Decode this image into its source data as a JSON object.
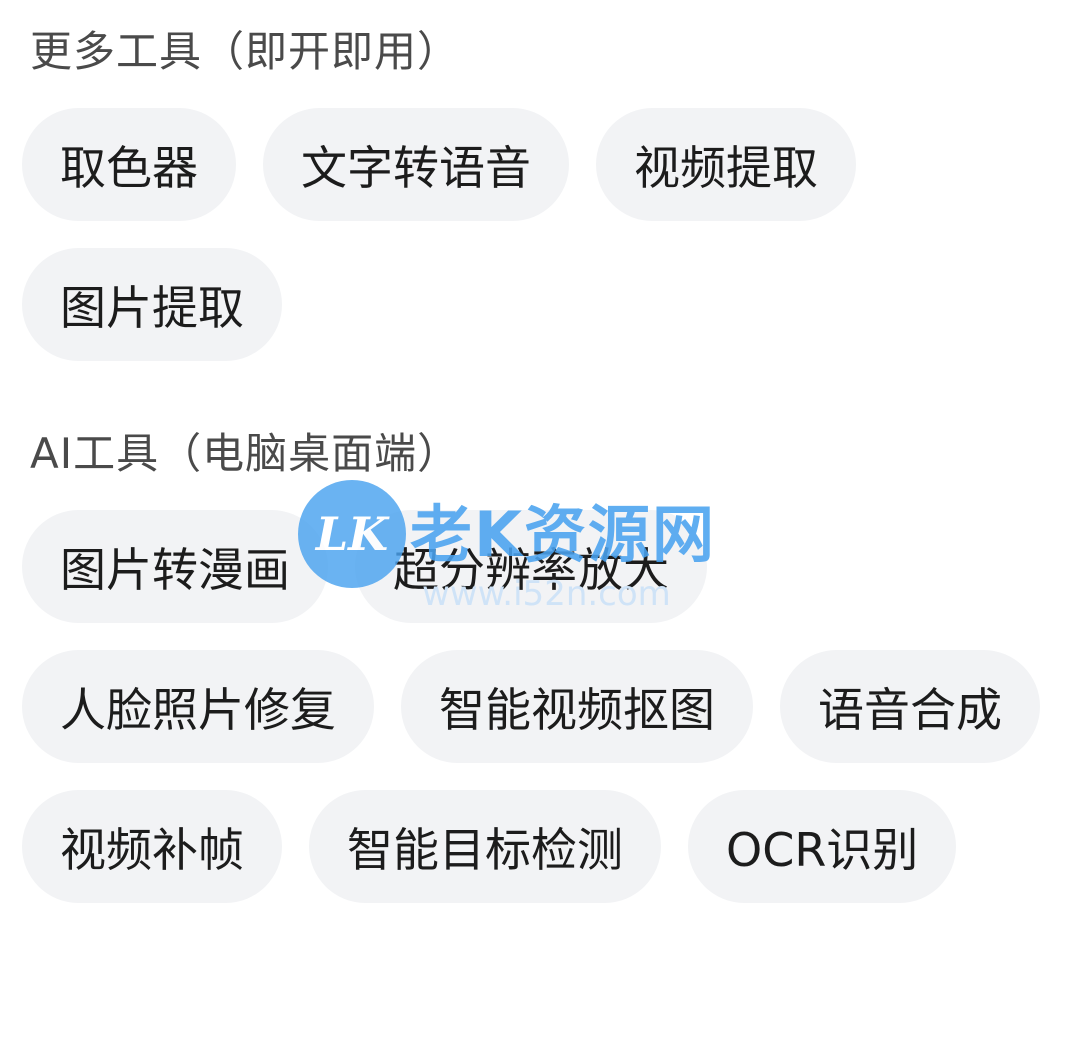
{
  "sections": [
    {
      "title": "更多工具（即开即用）",
      "chips": [
        "取色器",
        "文字转语音",
        "视频提取",
        "图片提取"
      ]
    },
    {
      "title": "AI工具（电脑桌面端）",
      "chips": [
        "图片转漫画",
        "超分辨率放大",
        "人脸照片修复",
        "智能视频抠图",
        "语音合成",
        "视频补帧",
        "智能目标检测",
        "OCR识别"
      ]
    }
  ],
  "watermark": {
    "badge": "LK",
    "brand": "老K资源网",
    "url": "www.i52n.com"
  },
  "colors": {
    "chip_background": "#f2f3f5",
    "section_title": "#4a4a4a",
    "chip_text": "#1c1c1c",
    "watermark": "#4aa3f0"
  }
}
